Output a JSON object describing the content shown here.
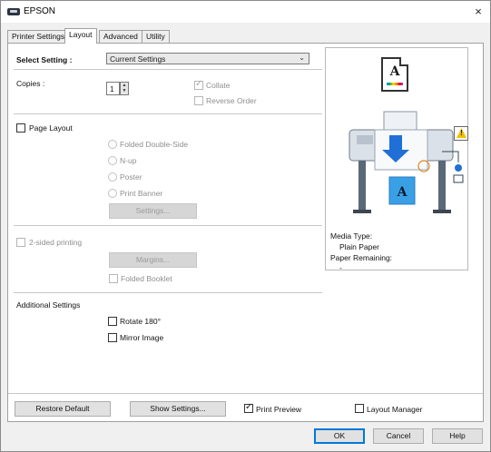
{
  "window": {
    "title": "EPSON",
    "close_glyph": "×"
  },
  "tabs": [
    {
      "label": "Printer Settings"
    },
    {
      "label": "Layout",
      "active": true
    },
    {
      "label": "Advanced"
    },
    {
      "label": "Utility"
    }
  ],
  "select_setting": {
    "label": "Select Setting :",
    "value": "Current Settings"
  },
  "copies": {
    "label": "Copies :",
    "value": "1"
  },
  "collate": {
    "label": "Collate",
    "checked": true,
    "enabled": false
  },
  "reverse_order": {
    "label": "Reverse Order",
    "checked": false,
    "enabled": false
  },
  "page_layout": {
    "label": "Page Layout",
    "checked": false,
    "options": [
      "Folded Double-Side",
      "N-up",
      "Poster",
      "Print Banner"
    ],
    "settings_button": "Settings..."
  },
  "two_sided": {
    "label": "2-sided printing",
    "checked": false,
    "margins_button": "Margins...",
    "folded_booklet": "Folded Booklet"
  },
  "additional": {
    "heading": "Additional Settings",
    "rotate": "Rotate 180°",
    "mirror": "Mirror Image"
  },
  "preview": {
    "media_type_label": "Media Type:",
    "media_type_value": "Plain Paper",
    "paper_remaining_label": "Paper Remaining:",
    "paper_remaining_value": "-",
    "doc_letter": "A",
    "paper_letter": "A",
    "icons": [
      "document-preview-icon",
      "warning-icon",
      "printer-image",
      "output-tray-icon"
    ]
  },
  "footer": {
    "restore_default": "Restore Default",
    "show_settings": "Show Settings...",
    "print_preview": {
      "label": "Print Preview",
      "checked": true
    },
    "layout_manager": {
      "label": "Layout Manager",
      "checked": false
    }
  },
  "buttons": {
    "ok": "OK",
    "cancel": "Cancel",
    "help": "Help"
  },
  "colors": {
    "accent": "#0078d7",
    "printer_screen": "#3aa0e6",
    "warning": "#f0c000"
  }
}
